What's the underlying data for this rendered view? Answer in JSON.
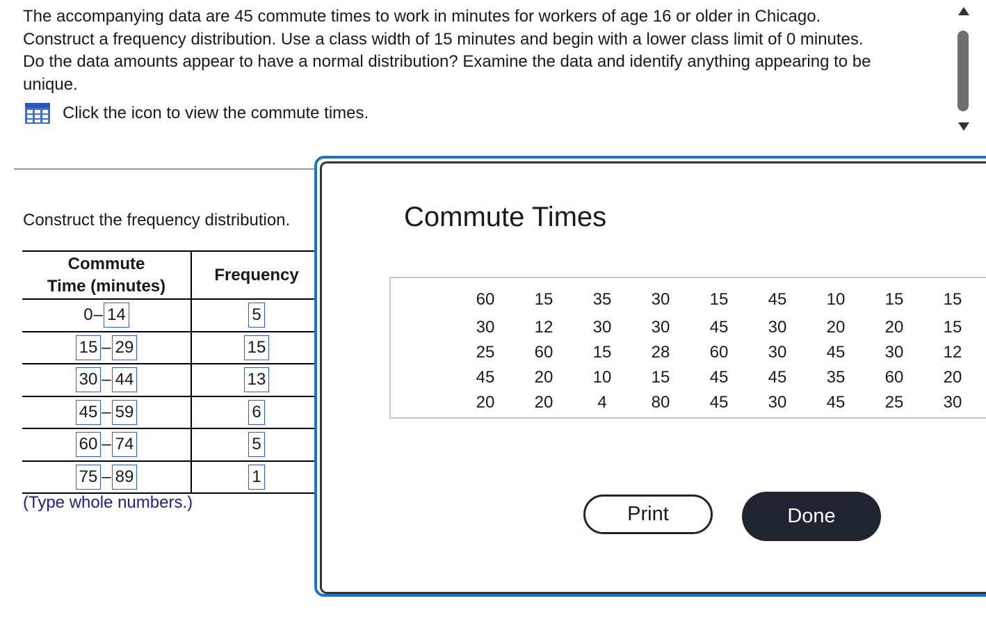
{
  "question": {
    "line1": "The accompanying data are 45 commute times to work in minutes for workers of age 16 or older in Chicago.",
    "line2": "Construct a frequency distribution. Use a class width of 15 minutes and begin with a lower class limit of 0 minutes.",
    "line3": "Do the data amounts appear to have a normal distribution? Examine the data and identify anything appearing to be",
    "line4": "unique.",
    "icon_text": "Click the icon to view the commute times."
  },
  "construct_label": "Construct the frequency distribution.",
  "freq_table": {
    "header_time_line1": "Commute",
    "header_time_line2": "Time (minutes)",
    "header_freq": "Frequency",
    "rows": [
      {
        "lower": "0",
        "upper": "14",
        "freq": "5"
      },
      {
        "lower": "15",
        "upper": "29",
        "freq": "15"
      },
      {
        "lower": "30",
        "upper": "44",
        "freq": "13"
      },
      {
        "lower": "45",
        "upper": "59",
        "freq": "6"
      },
      {
        "lower": "60",
        "upper": "74",
        "freq": "5"
      },
      {
        "lower": "75",
        "upper": "89",
        "freq": "1"
      }
    ],
    "dash": "–",
    "hint": "(Type whole numbers.)"
  },
  "modal": {
    "title": "Commute Times",
    "columns": [
      [
        "60",
        "30",
        "25",
        "45",
        "20"
      ],
      [
        "15",
        "12",
        "60",
        "20",
        "20"
      ],
      [
        "35",
        "30",
        "15",
        "10",
        "4"
      ],
      [
        "30",
        "30",
        "28",
        "15",
        "80"
      ],
      [
        "15",
        "45",
        "60",
        "45",
        "45"
      ],
      [
        "45",
        "30",
        "30",
        "45",
        "30"
      ],
      [
        "10",
        "20",
        "45",
        "35",
        "45"
      ],
      [
        "15",
        "20",
        "30",
        "60",
        "25"
      ],
      [
        "15",
        "15",
        "12",
        "20",
        "30"
      ]
    ],
    "print_label": "Print",
    "done_label": "Done"
  }
}
